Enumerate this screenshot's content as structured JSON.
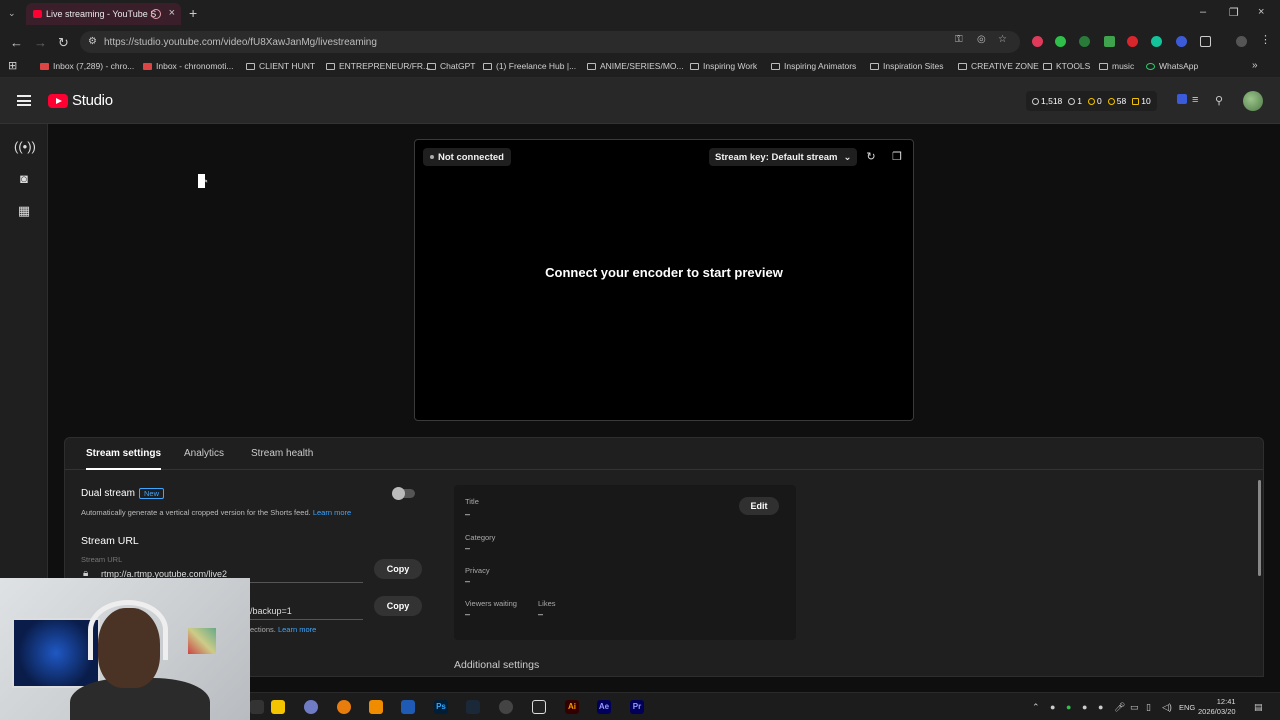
{
  "browser": {
    "tab_title": "Live streaming - YouTube S",
    "url": "https://studio.youtube.com/video/fU8XawJanMg/livestreaming",
    "bookmarks": [
      "Inbox (7,289) - chro...",
      "Inbox - chronomoti...",
      "CLIENT HUNT",
      "ENTREPRENEUR/FR...",
      "ChatGPT",
      "(1) Freelance Hub |...",
      "ANIME/SERIES/MO...",
      "Inspiring Work",
      "Inspiring Animators",
      "Inspiration Sites",
      "CREATIVE ZONE",
      "KTOOLS",
      "music",
      "WhatsApp"
    ]
  },
  "header": {
    "logo_text": "Studio",
    "stats": {
      "views": "1,518",
      "watching": "1",
      "clock": "0",
      "subs": "58",
      "points": "10"
    }
  },
  "preview": {
    "status": "Not connected",
    "stream_key": "Stream key: Default stream",
    "message": "Connect your encoder to start preview"
  },
  "panel": {
    "tabs": [
      "Stream settings",
      "Analytics",
      "Stream health"
    ],
    "dual_stream": {
      "label": "Dual stream",
      "badge": "New",
      "desc": "Automatically generate a vertical cropped version for the Shorts feed.",
      "learn_more": "Learn more"
    },
    "stream_url": {
      "heading": "Stream URL",
      "field_label": "Stream URL",
      "value": "rtmp://a.rtmp.youtube.com/live2",
      "copy": "Copy"
    },
    "backup": {
      "value_tail": "/backup=1",
      "desc_tail": "ections.",
      "learn_more": "Learn more",
      "copy": "Copy"
    },
    "info": {
      "title_label": "Title",
      "title_value": "–",
      "category_label": "Category",
      "category_value": "–",
      "privacy_label": "Privacy",
      "privacy_value": "–",
      "viewers_label": "Viewers waiting",
      "viewers_value": "–",
      "likes_label": "Likes",
      "likes_value": "–",
      "edit": "Edit"
    },
    "additional": "Additional settings"
  },
  "taskbar": {
    "lang": "ENG",
    "time": "12:41",
    "date": "2026/03/20"
  },
  "colors": {
    "youtube_red": "#ff0033",
    "link_blue": "#3ea6ff",
    "background": "#0f0f0f",
    "panel": "#1f1f1f"
  }
}
